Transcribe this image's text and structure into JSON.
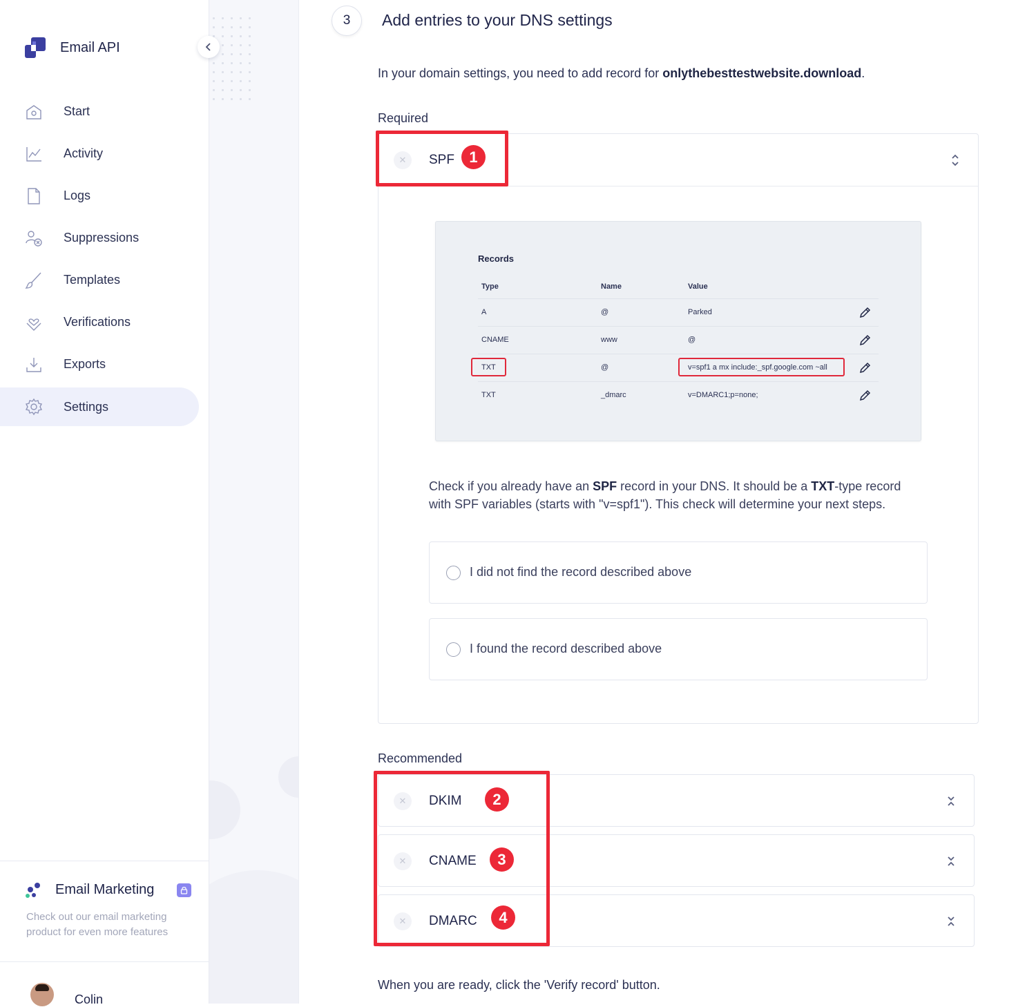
{
  "sidebar": {
    "brand": "Email API",
    "nav": [
      {
        "label": "Start",
        "icon": "home-icon"
      },
      {
        "label": "Activity",
        "icon": "chart-icon"
      },
      {
        "label": "Logs",
        "icon": "file-icon"
      },
      {
        "label": "Suppressions",
        "icon": "user-block-icon"
      },
      {
        "label": "Templates",
        "icon": "brush-icon"
      },
      {
        "label": "Verifications",
        "icon": "heart-hand-icon"
      },
      {
        "label": "Exports",
        "icon": "download-icon"
      },
      {
        "label": "Settings",
        "icon": "gear-icon",
        "active": true
      }
    ],
    "promo": {
      "title": "Email Marketing",
      "text": "Check out our email marketing product for even more features"
    },
    "user": {
      "name": "Colin"
    }
  },
  "step": {
    "number": "3",
    "title": "Add entries to your DNS settings",
    "intro_prefix": "In your domain settings, you need to add record for ",
    "domain": "onlythebesttestwebsite.download",
    "intro_suffix": "."
  },
  "required": {
    "label": "Required",
    "spf": {
      "title": "SPF",
      "badge": "1",
      "records": {
        "title": "Records",
        "headers": [
          "Type",
          "Name",
          "Value"
        ],
        "rows": [
          {
            "type": "A",
            "name": "@",
            "value": "Parked"
          },
          {
            "type": "CNAME",
            "name": "www",
            "value": "@"
          },
          {
            "type": "TXT",
            "name": "@",
            "value": "v=spf1 a mx include:_spf.google.com ~all"
          },
          {
            "type": "TXT",
            "name": "_dmarc",
            "value": "v=DMARC1;p=none;"
          }
        ]
      },
      "desc": {
        "p1": "Check if you already have an ",
        "b1": "SPF",
        "p2": " record in your DNS. It should be a ",
        "b2": "TXT",
        "p3": "-type record with SPF variables (starts with \"v=spf1\"). This check will determine your next steps."
      },
      "options": [
        "I did not find the record described above",
        "I found the record described above"
      ]
    }
  },
  "recommended": {
    "label": "Recommended",
    "items": [
      {
        "title": "DKIM",
        "badge": "2"
      },
      {
        "title": "CNAME",
        "badge": "3"
      },
      {
        "title": "DMARC",
        "badge": "4"
      }
    ]
  },
  "footer": "When you are ready, click the 'Verify record' button.",
  "colors": {
    "accent": "#3b3fa0",
    "highlight_red": "#ec2837",
    "active_bg": "#eef0fb"
  }
}
